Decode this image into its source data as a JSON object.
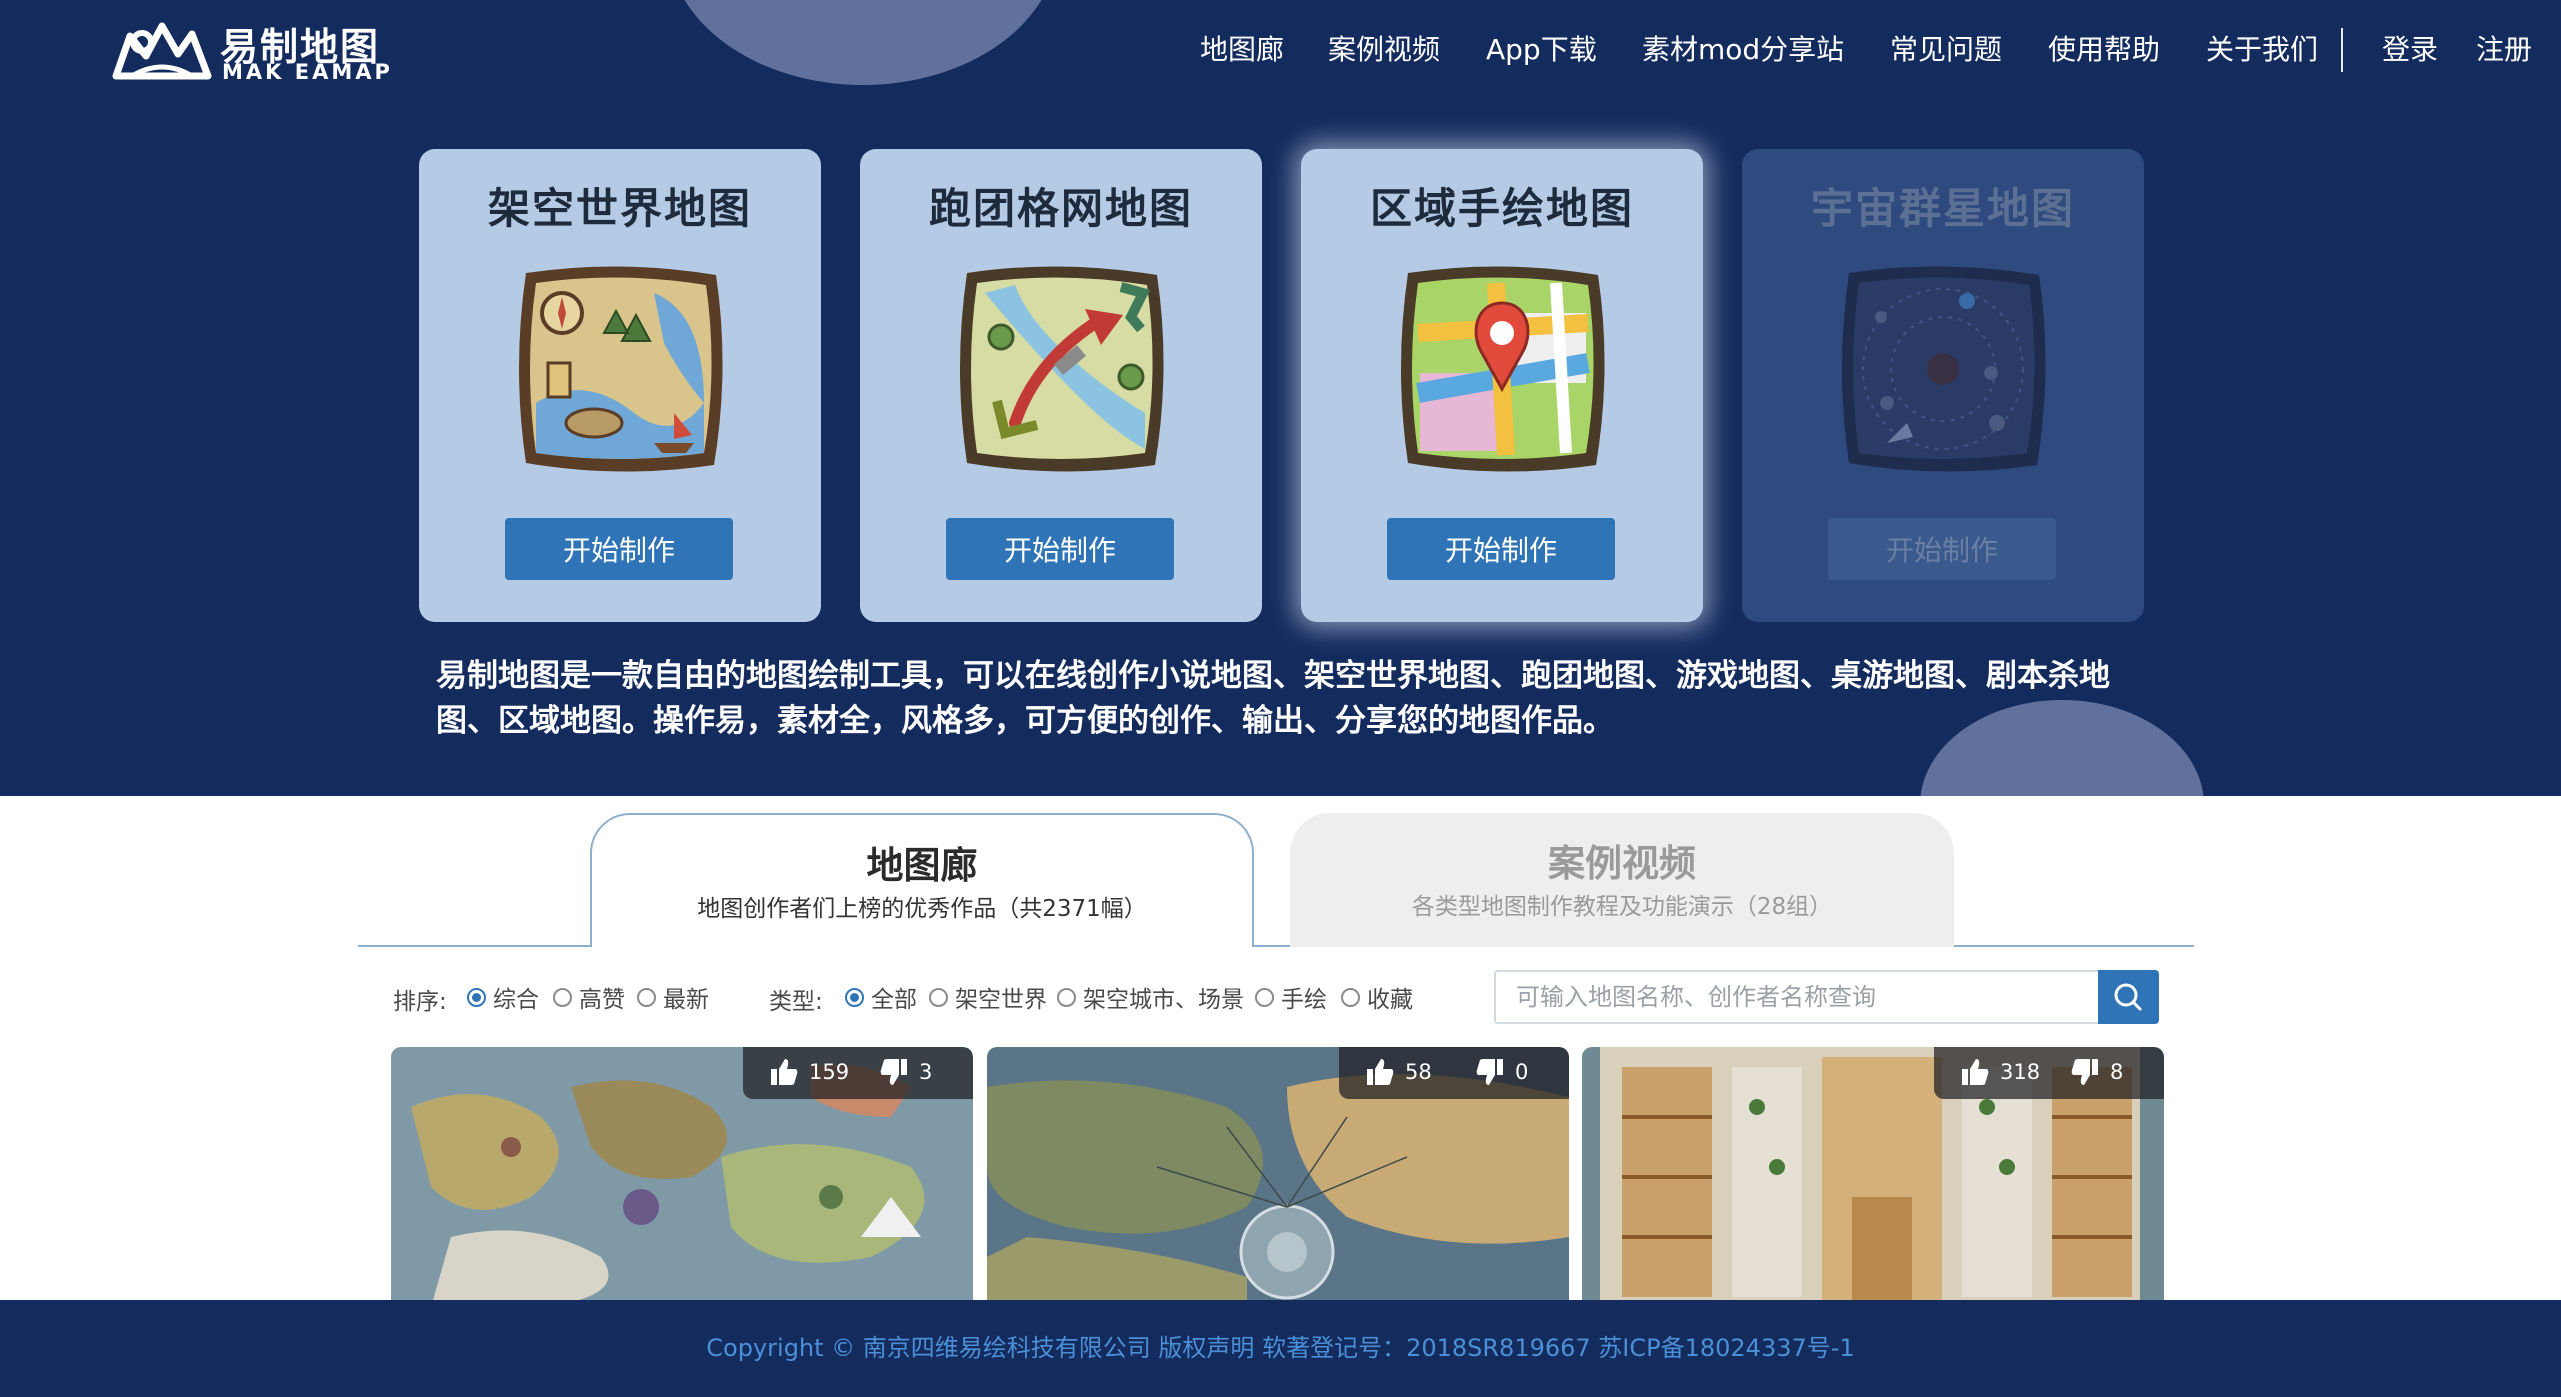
{
  "header": {
    "logo_title": "易制地图",
    "logo_subtitle": "MAK EAMAP",
    "nav": [
      {
        "label": "地图廊"
      },
      {
        "label": "案例视频"
      },
      {
        "label": "App下载"
      },
      {
        "label": "素材mod分享站"
      },
      {
        "label": "常见问题"
      },
      {
        "label": "使用帮助"
      },
      {
        "label": "关于我们"
      },
      {
        "label": "登录"
      },
      {
        "label": "注册"
      }
    ]
  },
  "cards": [
    {
      "title": "架空世界地图",
      "button": "开始制作",
      "icon": "fantasy-world-map-icon",
      "enabled": true
    },
    {
      "title": "跑团格网地图",
      "button": "开始制作",
      "icon": "trpg-grid-map-icon",
      "enabled": true
    },
    {
      "title": "区域手绘地图",
      "button": "开始制作",
      "icon": "regional-hand-drawn-map-icon",
      "enabled": true
    },
    {
      "title": "宇宙群星地图",
      "button": "开始制作",
      "icon": "cosmic-star-map-icon",
      "enabled": false
    }
  ],
  "intro": "易制地图是一款自由的地图绘制工具，可以在线创作小说地图、架空世界地图、跑团地图、游戏地图、桌游地图、剧本杀地图、区域地图。操作易，素材全，风格多，可方便的创作、输出、分享您的地图作品。",
  "tabs": [
    {
      "title": "地图廊",
      "subtitle": "地图创作者们上榜的优秀作品（共2371幅）",
      "active": true
    },
    {
      "title": "案例视频",
      "subtitle": "各类型地图制作教程及功能演示（28组）",
      "active": false
    }
  ],
  "filters": {
    "sort_label": "排序:",
    "sort_options": [
      "综合",
      "高赞",
      "最新"
    ],
    "sort_selected": "综合",
    "type_label": "类型:",
    "type_options": [
      "全部",
      "架空世界",
      "架空城市、场景",
      "手绘",
      "收藏"
    ],
    "type_selected": "全部",
    "search_placeholder": "可输入地图名称、创作者名称查询"
  },
  "gallery": [
    {
      "likes": "159",
      "dislikes": "3"
    },
    {
      "likes": "58",
      "dislikes": "0"
    },
    {
      "likes": "318",
      "dislikes": "8"
    }
  ],
  "footer": {
    "text": "Copyright © 南京四维易绘科技有限公司   版权声明   软著登记号：2018SR819667   苏ICP备18024337号-1"
  },
  "colors": {
    "hero_bg": "#142b5e",
    "card_bg": "#b5cbe5",
    "card_disabled_bg": "#2f4a7f",
    "accent": "#2f74b6",
    "footer_text": "#4b8fd6"
  }
}
